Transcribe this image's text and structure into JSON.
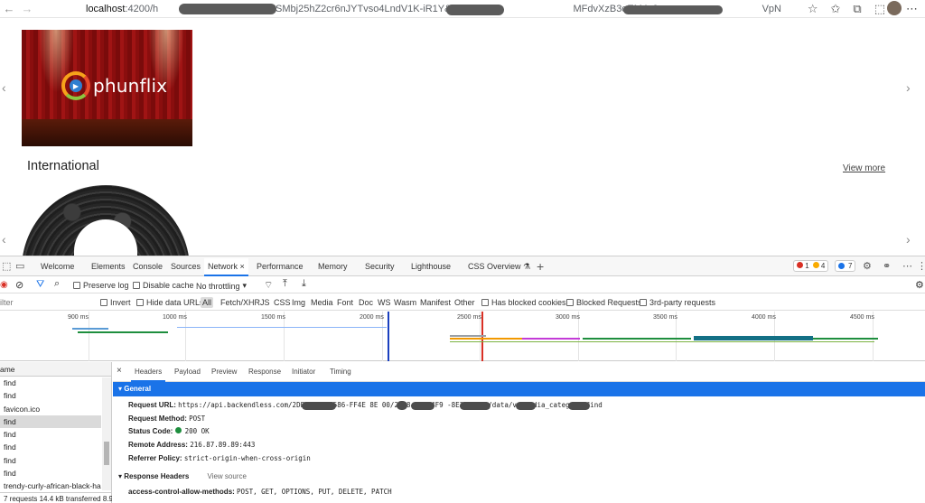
{
  "browser": {
    "url_host": "localhost",
    "url_port_path": ":4200/h",
    "url_fragments": [
      "Q-SMbj25hZ2cr6nJYTvso4LndV1K-iR1Y&state",
      "MFdvXzB3eEM4c0",
      "VpN"
    ]
  },
  "page": {
    "logo_text": "phunflix",
    "section_title": "International",
    "view_more": "View more"
  },
  "devtools": {
    "tabs": [
      "Welcome",
      "Elements",
      "Console",
      "Sources",
      "Network",
      "Performance",
      "Memory",
      "Security",
      "Lighthouse",
      "CSS Overview"
    ],
    "active_tab": "Network",
    "badges": {
      "errors": "1",
      "warnings": "4",
      "info": "7"
    },
    "toolbar": {
      "preserve_log": "Preserve log",
      "disable_cache": "Disable cache",
      "throttling": "No throttling"
    },
    "filter": {
      "placeholder": "ilter",
      "invert": "Invert",
      "hide_data_urls": "Hide data URLs",
      "types": [
        "All",
        "Fetch/XHR",
        "JS",
        "CSS",
        "Img",
        "Media",
        "Font",
        "Doc",
        "WS",
        "Wasm",
        "Manifest",
        "Other"
      ],
      "has_blocked_cookies": "Has blocked cookies",
      "blocked_requests": "Blocked Requests",
      "third_party": "3rd-party requests"
    },
    "timeline_ticks": [
      "900 ms",
      "1000 ms",
      "1500 ms",
      "2000 ms",
      "2500 ms",
      "3000 ms",
      "3500 ms",
      "4000 ms",
      "4500 ms"
    ],
    "request_list": {
      "header": "ame",
      "rows": [
        "find",
        "find",
        "favicon.ico",
        "find",
        "find",
        "find",
        "find",
        "find",
        "trendy-curly-african-black-hai"
      ],
      "selected_index": 3,
      "status": "7 requests  14.4 kB transferred  8.9"
    },
    "detail_tabs": [
      "Headers",
      "Payload",
      "Preview",
      "Response",
      "Initiator",
      "Timing"
    ],
    "active_detail_tab": "Headers",
    "general": {
      "title": "General",
      "request_url_label": "Request URL:",
      "request_url": "https://api.backendless.com/2DEB745C    D586-FF4E   8E    00/2478   8B-44F9   -8E352EA   0/data/vp_media_category/find",
      "request_method_label": "Request Method:",
      "request_method": "POST",
      "status_code_label": "Status Code:",
      "status_code": "200 OK",
      "remote_address_label": "Remote Address:",
      "remote_address": "216.87.89.89:443",
      "referrer_policy_label": "Referrer Policy:",
      "referrer_policy": "strict-origin-when-cross-origin"
    },
    "response_headers": {
      "title": "Response Headers",
      "view_source": "View source",
      "allow_methods_label": "access-control-allow-methods:",
      "allow_methods": "POST, GET, OPTIONS, PUT, DELETE, PATCH"
    }
  }
}
